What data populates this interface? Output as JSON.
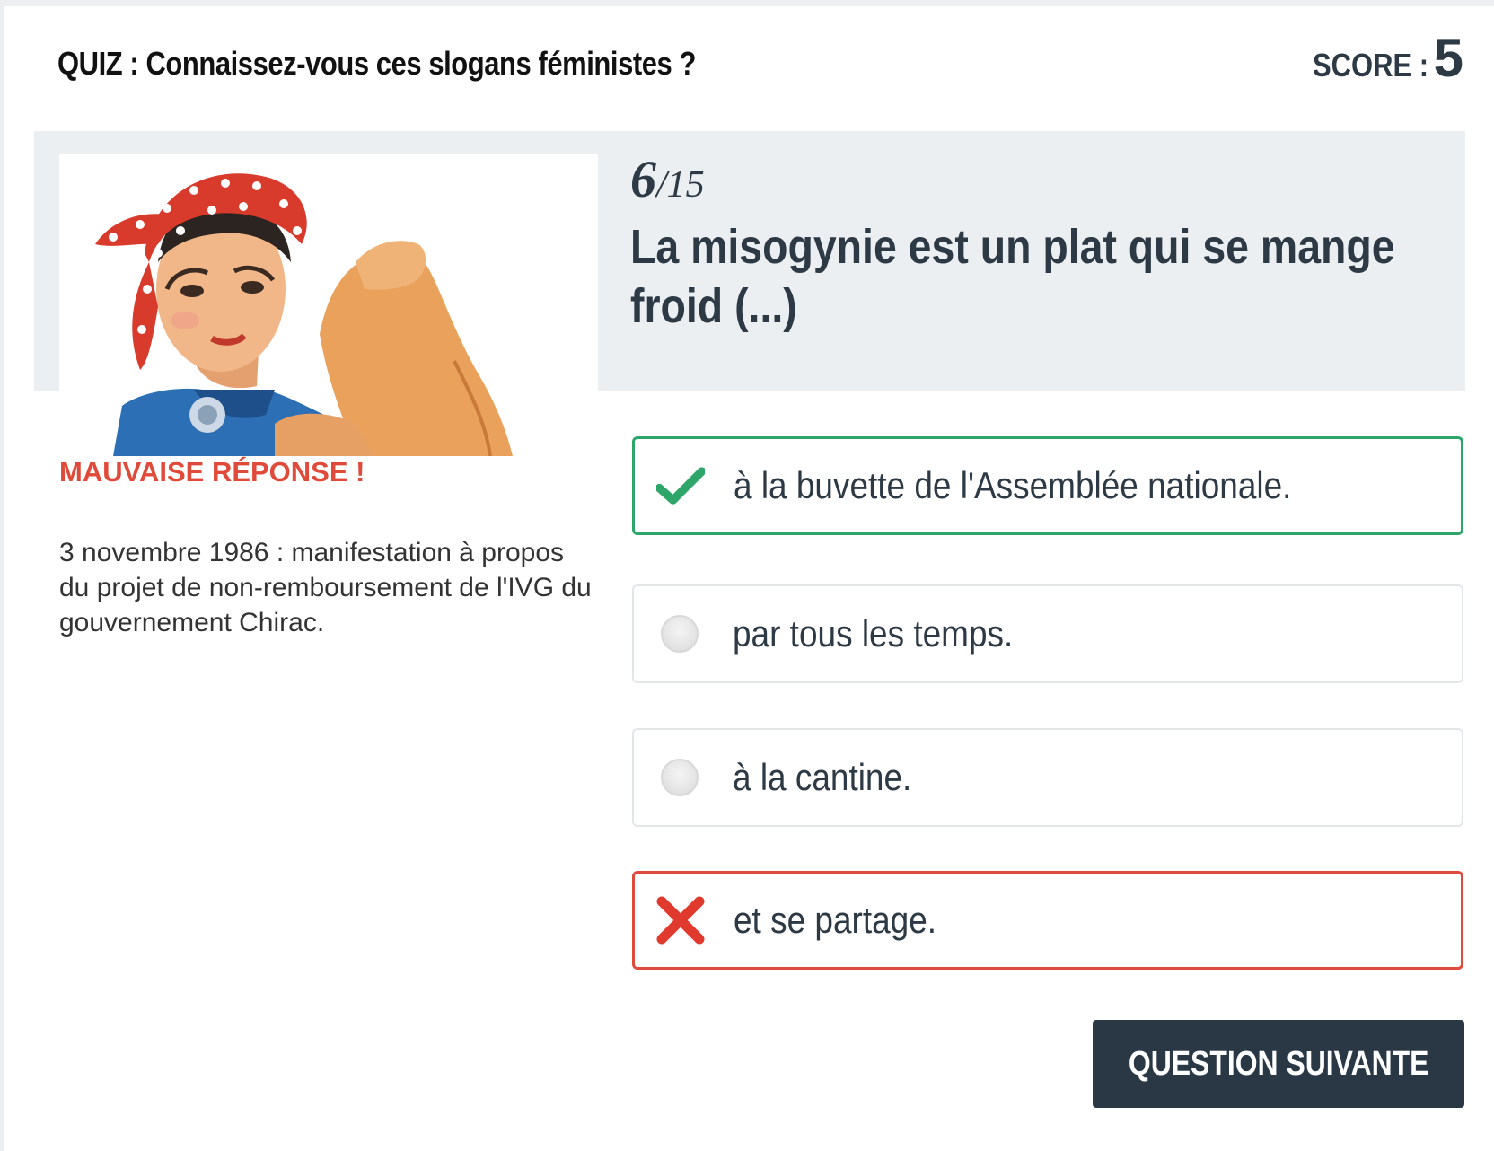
{
  "header": {
    "title": "QUIZ : Connaissez-vous ces slogans féministes ?",
    "score_label": "SCORE :",
    "score_value": "5"
  },
  "question": {
    "number": "6",
    "total": "/15",
    "text": "La misogynie est un plat qui se mange froid (...)"
  },
  "feedback": {
    "verdict": "MAUVAISE RÉPONSE !",
    "caption": "3 novembre 1986 : manifestation à propos du projet de non-remboursement de l'IVG du gouvernement Chirac."
  },
  "image": {
    "subject": "we-can-do-it-poster"
  },
  "answers": [
    {
      "label": "à la buvette de l'Assemblée nationale.",
      "state": "correct",
      "icon": "check-icon"
    },
    {
      "label": "par tous les temps.",
      "state": "unselected",
      "icon": "radio"
    },
    {
      "label": "à la cantine.",
      "state": "unselected",
      "icon": "radio"
    },
    {
      "label": "et se partage.",
      "state": "wrong",
      "icon": "cross-icon"
    }
  ],
  "actions": {
    "next_label": "QUESTION SUIVANTE"
  },
  "colors": {
    "correct": "#2ea66a",
    "wrong": "#de4b3c",
    "primary": "#2a3846",
    "band": "#eceff1"
  }
}
